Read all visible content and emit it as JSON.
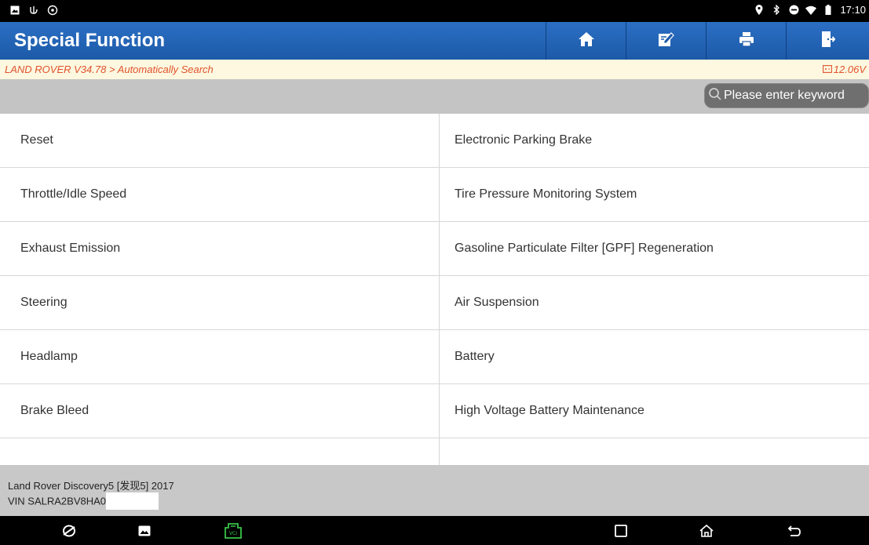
{
  "status_bar": {
    "time": "17:10"
  },
  "header": {
    "title": "Special Function"
  },
  "toolbar": {
    "home_icon": "home-icon",
    "edit_icon": "edit-icon",
    "print_icon": "print-icon",
    "exit_icon": "exit-icon"
  },
  "breadcrumb": "LAND ROVER V34.78 > Automatically Search",
  "voltage": "12.06V",
  "search": {
    "placeholder": "Please enter keyword"
  },
  "functions": [
    [
      "Reset",
      "Electronic Parking Brake"
    ],
    [
      "Throttle/Idle Speed",
      "Tire Pressure Monitoring System"
    ],
    [
      "Exhaust Emission",
      "Gasoline Particulate Filter [GPF] Regeneration"
    ],
    [
      "Steering",
      "Air Suspension"
    ],
    [
      "Headlamp",
      "Battery"
    ],
    [
      "Brake Bleed",
      "High Voltage Battery Maintenance"
    ]
  ],
  "vehicle": {
    "model": "Land Rover Discovery5 [发现5] 2017",
    "vin": "VIN SALRA2BV8HA0"
  },
  "colors": {
    "header": "#1d5aa8",
    "breadcrumb_text": "#e0522e",
    "vci_green": "#37c34a"
  }
}
